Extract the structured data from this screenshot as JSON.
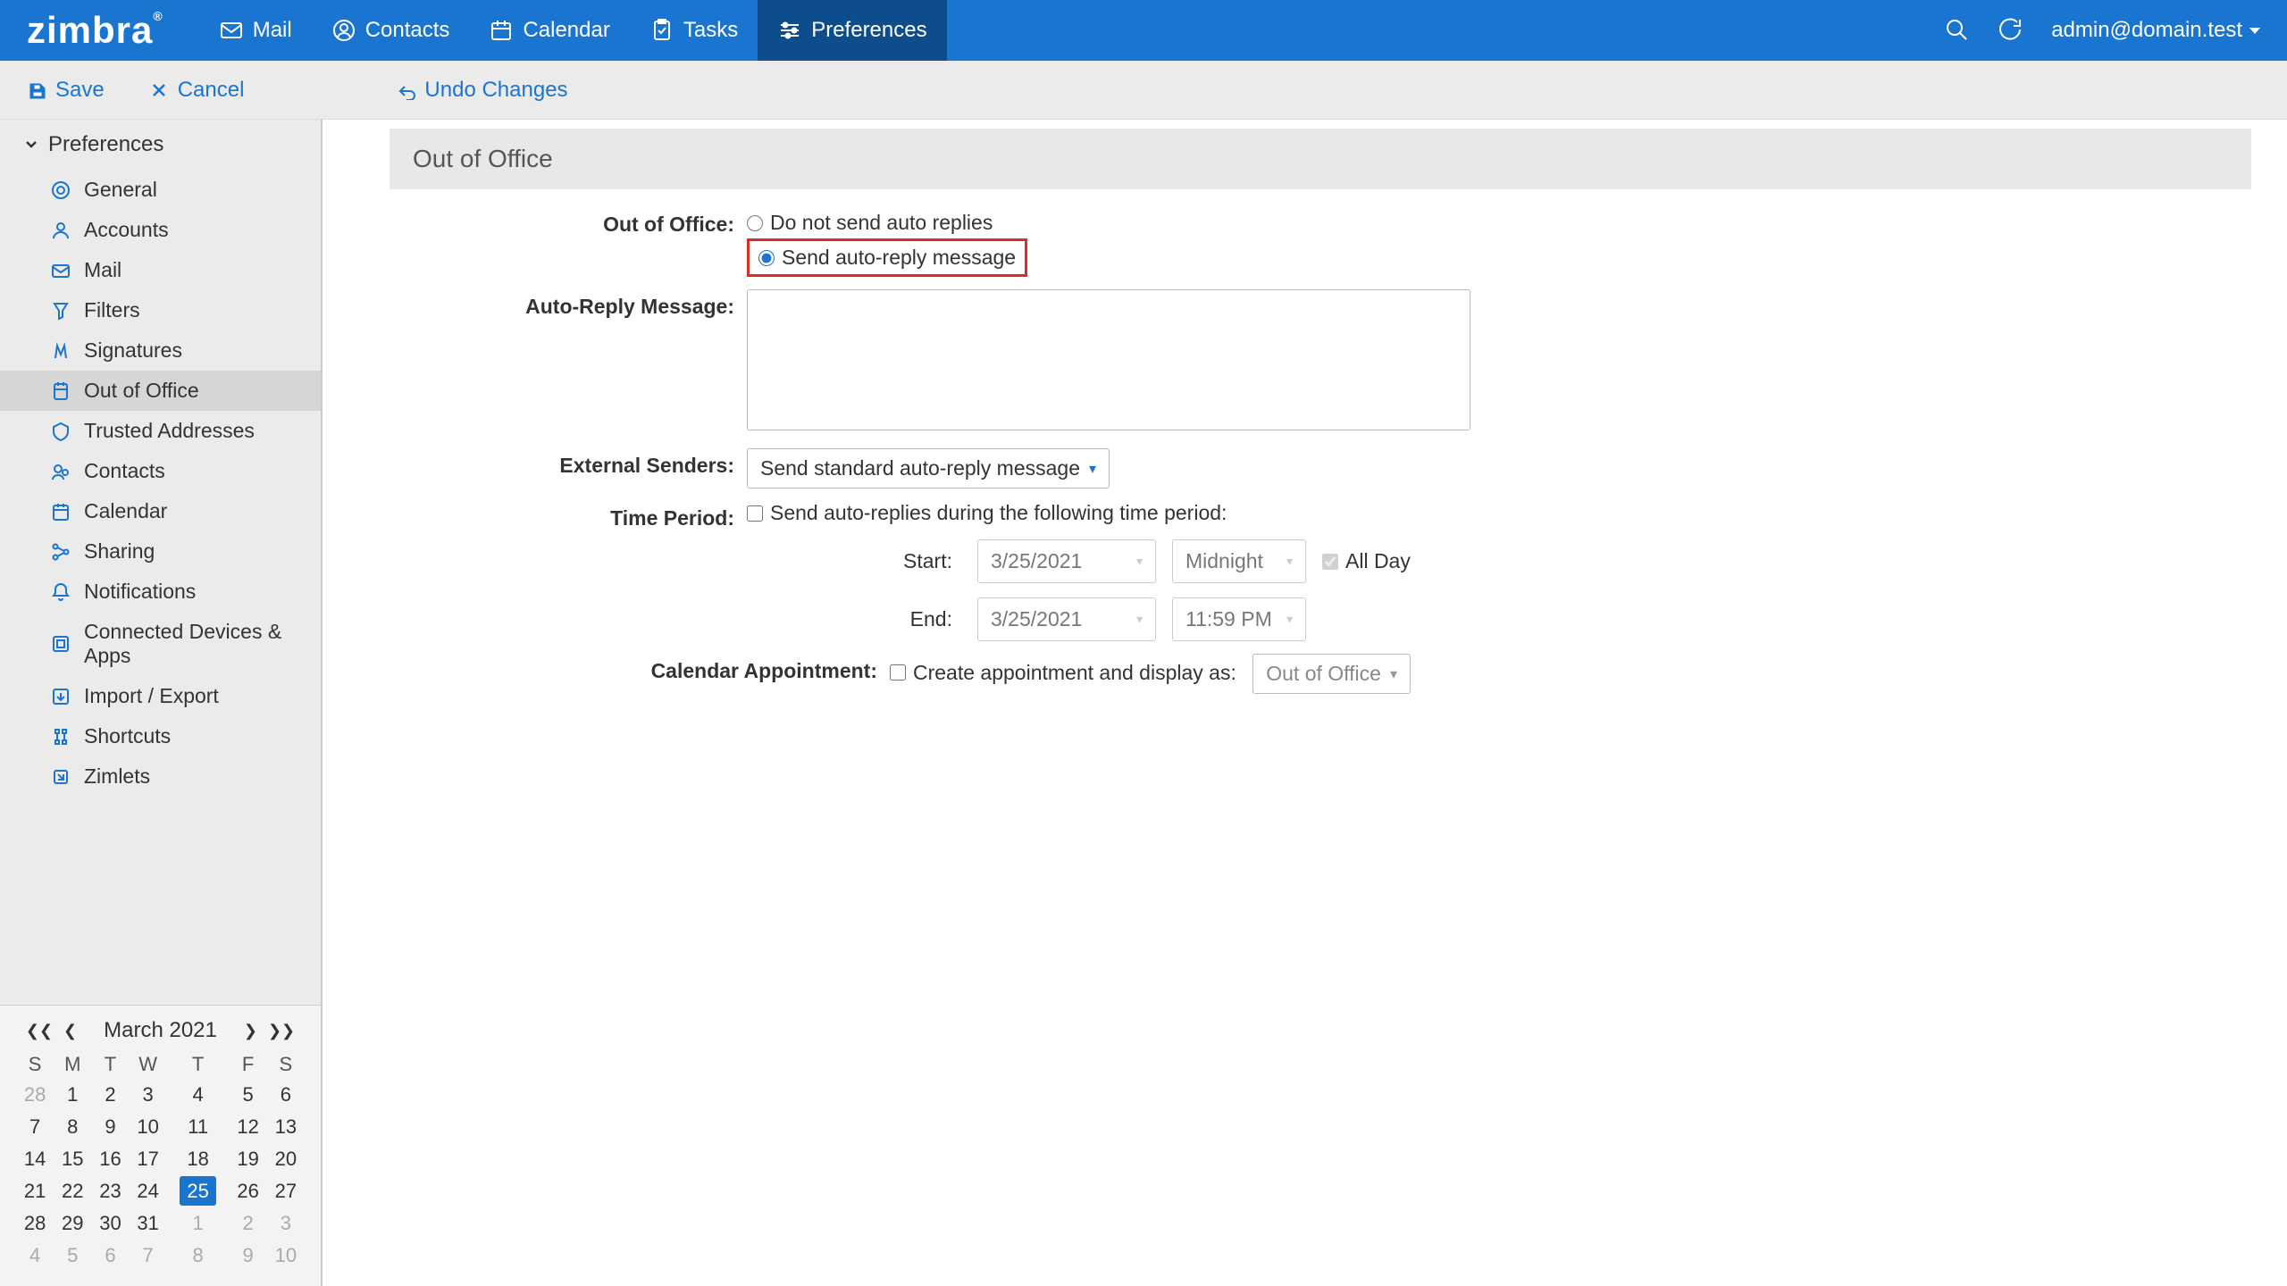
{
  "logo": "zimbra",
  "topnav": {
    "mail": "Mail",
    "contacts": "Contacts",
    "calendar": "Calendar",
    "tasks": "Tasks",
    "preferences": "Preferences"
  },
  "user_email": "admin@domain.test",
  "actions": {
    "save": "Save",
    "cancel": "Cancel",
    "undo": "Undo Changes"
  },
  "sidebar": {
    "header": "Preferences",
    "items": [
      "General",
      "Accounts",
      "Mail",
      "Filters",
      "Signatures",
      "Out of Office",
      "Trusted Addresses",
      "Contacts",
      "Calendar",
      "Sharing",
      "Notifications",
      "Connected Devices & Apps",
      "Import / Export",
      "Shortcuts",
      "Zimlets"
    ],
    "selected_index": 5
  },
  "panel": {
    "title": "Out of Office",
    "labels": {
      "ooo": "Out of Office:",
      "msg": "Auto-Reply Message:",
      "ext": "External Senders:",
      "period": "Time Period:",
      "start": "Start:",
      "end": "End:",
      "allday": "All Day",
      "calappt": "Calendar Appointment:"
    },
    "radio_off": "Do not send auto replies",
    "radio_on": "Send auto-reply message",
    "ext_select": "Send standard auto-reply message",
    "period_check": "Send auto-replies during the following time period:",
    "start_date": "3/25/2021",
    "start_time": "Midnight",
    "end_date": "3/25/2021",
    "end_time": "11:59 PM",
    "cal_check": "Create appointment and display as:",
    "cal_select": "Out of Office"
  },
  "minical": {
    "month": "March 2021",
    "dow": [
      "S",
      "M",
      "T",
      "W",
      "T",
      "F",
      "S"
    ],
    "weeks": [
      [
        {
          "d": "28",
          "dim": true
        },
        {
          "d": "1"
        },
        {
          "d": "2"
        },
        {
          "d": "3"
        },
        {
          "d": "4"
        },
        {
          "d": "5"
        },
        {
          "d": "6"
        }
      ],
      [
        {
          "d": "7"
        },
        {
          "d": "8"
        },
        {
          "d": "9"
        },
        {
          "d": "10"
        },
        {
          "d": "11"
        },
        {
          "d": "12"
        },
        {
          "d": "13"
        }
      ],
      [
        {
          "d": "14"
        },
        {
          "d": "15"
        },
        {
          "d": "16"
        },
        {
          "d": "17"
        },
        {
          "d": "18"
        },
        {
          "d": "19"
        },
        {
          "d": "20"
        }
      ],
      [
        {
          "d": "21"
        },
        {
          "d": "22"
        },
        {
          "d": "23"
        },
        {
          "d": "24"
        },
        {
          "d": "25",
          "today": true
        },
        {
          "d": "26"
        },
        {
          "d": "27"
        }
      ],
      [
        {
          "d": "28"
        },
        {
          "d": "29"
        },
        {
          "d": "30"
        },
        {
          "d": "31"
        },
        {
          "d": "1",
          "dim": true
        },
        {
          "d": "2",
          "dim": true
        },
        {
          "d": "3",
          "dim": true
        }
      ],
      [
        {
          "d": "4",
          "dim": true
        },
        {
          "d": "5",
          "dim": true
        },
        {
          "d": "6",
          "dim": true
        },
        {
          "d": "7",
          "dim": true
        },
        {
          "d": "8",
          "dim": true
        },
        {
          "d": "9",
          "dim": true
        },
        {
          "d": "10",
          "dim": true
        }
      ]
    ]
  }
}
